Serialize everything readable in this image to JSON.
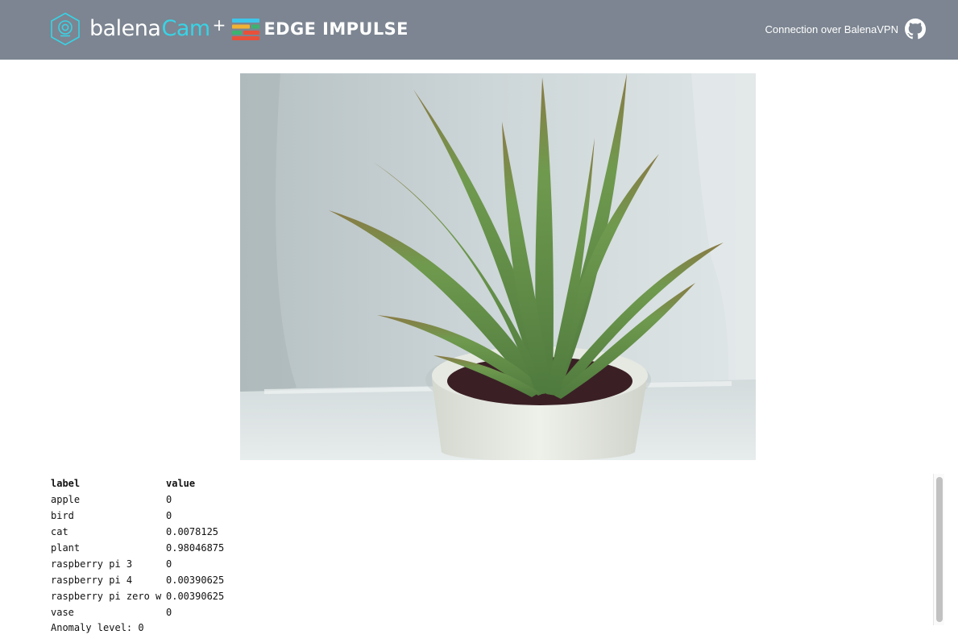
{
  "header": {
    "brand_balena": "balena",
    "brand_cam": "Cam",
    "brand_plus": "+",
    "brand_partner": "EDGE IMPULSE",
    "connection_text": "Connection over BalenaVPN"
  },
  "results": {
    "columns": [
      "label",
      "value"
    ],
    "rows": [
      {
        "label": "apple",
        "value": "0"
      },
      {
        "label": "bird",
        "value": "0"
      },
      {
        "label": "cat",
        "value": "0.0078125"
      },
      {
        "label": "plant",
        "value": "0.98046875"
      },
      {
        "label": "raspberry pi 3",
        "value": "0"
      },
      {
        "label": "raspberry pi 4",
        "value": "0.00390625"
      },
      {
        "label": "raspberry pi zero w",
        "value": "0.00390625"
      },
      {
        "label": "vase",
        "value": "0"
      }
    ],
    "anomaly_text": "Anomaly level: 0"
  },
  "colors": {
    "header_bg": "#7c8591",
    "accent_cam": "#38d3e6",
    "edge_impulse_stripes": [
      "#3ec6ea",
      "#f2b233",
      "#3cb371",
      "#e8503a"
    ]
  },
  "icons": {
    "camera_logo": "balena-cam-logo-icon",
    "partner_logo": "edge-impulse-logo-icon",
    "github": "github-icon"
  }
}
